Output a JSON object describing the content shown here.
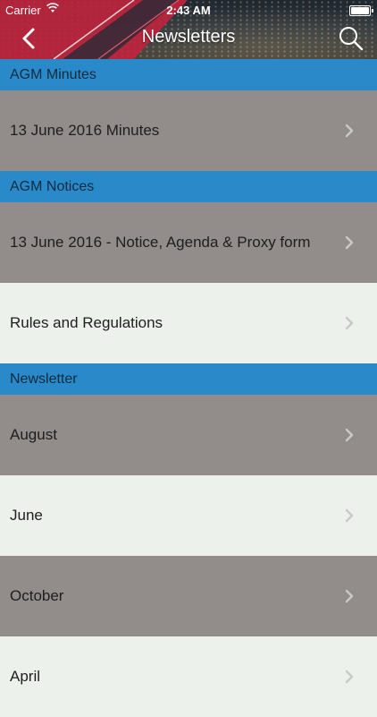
{
  "status": {
    "carrier": "Carrier",
    "time": "2:43 AM"
  },
  "header": {
    "title": "Newsletters"
  },
  "sections": [
    {
      "header": "AGM Minutes",
      "rows": [
        "13 June 2016 Minutes"
      ]
    },
    {
      "header": "AGM Notices",
      "rows": [
        "13 June 2016 - Notice, Agenda & Proxy form",
        "Rules and Regulations"
      ]
    },
    {
      "header": "Newsletter",
      "rows": [
        "August",
        "June",
        "October",
        "April"
      ]
    }
  ],
  "colors": {
    "section": "#2a8ac9",
    "row_dark": "#928c8a",
    "row_light": "#edf1ec"
  },
  "icons": {
    "back": "chevron-left-icon",
    "search": "search-icon",
    "row": "chevron-right-icon"
  }
}
